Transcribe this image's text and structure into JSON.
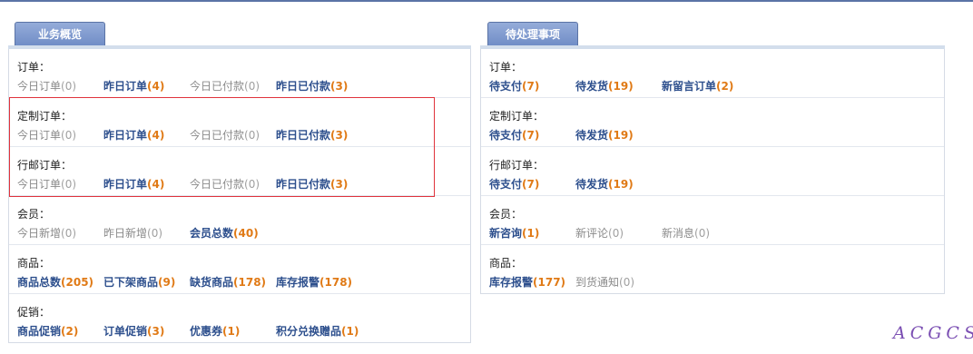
{
  "left_panel": {
    "tab": "业务概览",
    "sections": [
      {
        "title": "订单：",
        "items": [
          {
            "label": "今日订单",
            "count": "(0)",
            "active": false
          },
          {
            "label": "昨日订单",
            "count": "(4)",
            "active": true
          },
          {
            "label": "今日已付款",
            "count": "(0)",
            "active": false
          },
          {
            "label": "昨日已付款",
            "count": "(3)",
            "active": true
          }
        ]
      },
      {
        "title": "定制订单：",
        "items": [
          {
            "label": "今日订单",
            "count": "(0)",
            "active": false
          },
          {
            "label": "昨日订单",
            "count": "(4)",
            "active": true
          },
          {
            "label": "今日已付款",
            "count": "(0)",
            "active": false
          },
          {
            "label": "昨日已付款",
            "count": "(3)",
            "active": true
          }
        ]
      },
      {
        "title": "行邮订单：",
        "items": [
          {
            "label": "今日订单",
            "count": "(0)",
            "active": false
          },
          {
            "label": "昨日订单",
            "count": "(4)",
            "active": true
          },
          {
            "label": "今日已付款",
            "count": "(0)",
            "active": false
          },
          {
            "label": "昨日已付款",
            "count": "(3)",
            "active": true
          }
        ]
      },
      {
        "title": "会员：",
        "items": [
          {
            "label": "今日新增",
            "count": "(0)",
            "active": false
          },
          {
            "label": "昨日新增",
            "count": "(0)",
            "active": false
          },
          {
            "label": "会员总数",
            "count": "(40)",
            "active": true
          }
        ]
      },
      {
        "title": "商品：",
        "items": [
          {
            "label": "商品总数",
            "count": "(205)",
            "active": true
          },
          {
            "label": "已下架商品",
            "count": "(9)",
            "active": true
          },
          {
            "label": "缺货商品",
            "count": "(178)",
            "active": true
          },
          {
            "label": "库存报警",
            "count": "(178)",
            "active": true
          }
        ]
      },
      {
        "title": "促销：",
        "items": [
          {
            "label": "商品促销",
            "count": "(2)",
            "active": true
          },
          {
            "label": "订单促销",
            "count": "(3)",
            "active": true
          },
          {
            "label": "优惠券",
            "count": "(1)",
            "active": true
          },
          {
            "label": "积分兑换赠品",
            "count": "(1)",
            "active": true
          }
        ]
      }
    ]
  },
  "right_panel": {
    "tab": "待处理事项",
    "sections": [
      {
        "title": "订单：",
        "items": [
          {
            "label": "待支付",
            "count": "(7)",
            "active": true
          },
          {
            "label": "待发货",
            "count": "(19)",
            "active": true
          },
          {
            "label": "新留言订单",
            "count": "(2)",
            "active": true
          }
        ]
      },
      {
        "title": "定制订单：",
        "items": [
          {
            "label": "待支付",
            "count": "(7)",
            "active": true
          },
          {
            "label": "待发货",
            "count": "(19)",
            "active": true
          }
        ]
      },
      {
        "title": "行邮订单：",
        "items": [
          {
            "label": "待支付",
            "count": "(7)",
            "active": true
          },
          {
            "label": "待发货",
            "count": "(19)",
            "active": true
          }
        ]
      },
      {
        "title": "会员：",
        "items": [
          {
            "label": "新咨询",
            "count": "(1)",
            "active": true
          },
          {
            "label": "新评论",
            "count": "(0)",
            "active": false
          },
          {
            "label": "新消息",
            "count": "(0)",
            "active": false
          }
        ]
      },
      {
        "title": "商品：",
        "items": [
          {
            "label": "库存报警",
            "count": "(177)",
            "active": true
          },
          {
            "label": "到货通知",
            "count": "(0)",
            "active": false
          }
        ]
      }
    ]
  },
  "watermark": "ACGCSS",
  "colors": {
    "link": "#2d4f8d",
    "count": "#e07a16",
    "muted": "#8a8a8a",
    "tab": "#7a94cc",
    "highlight_border": "#e0333c"
  }
}
